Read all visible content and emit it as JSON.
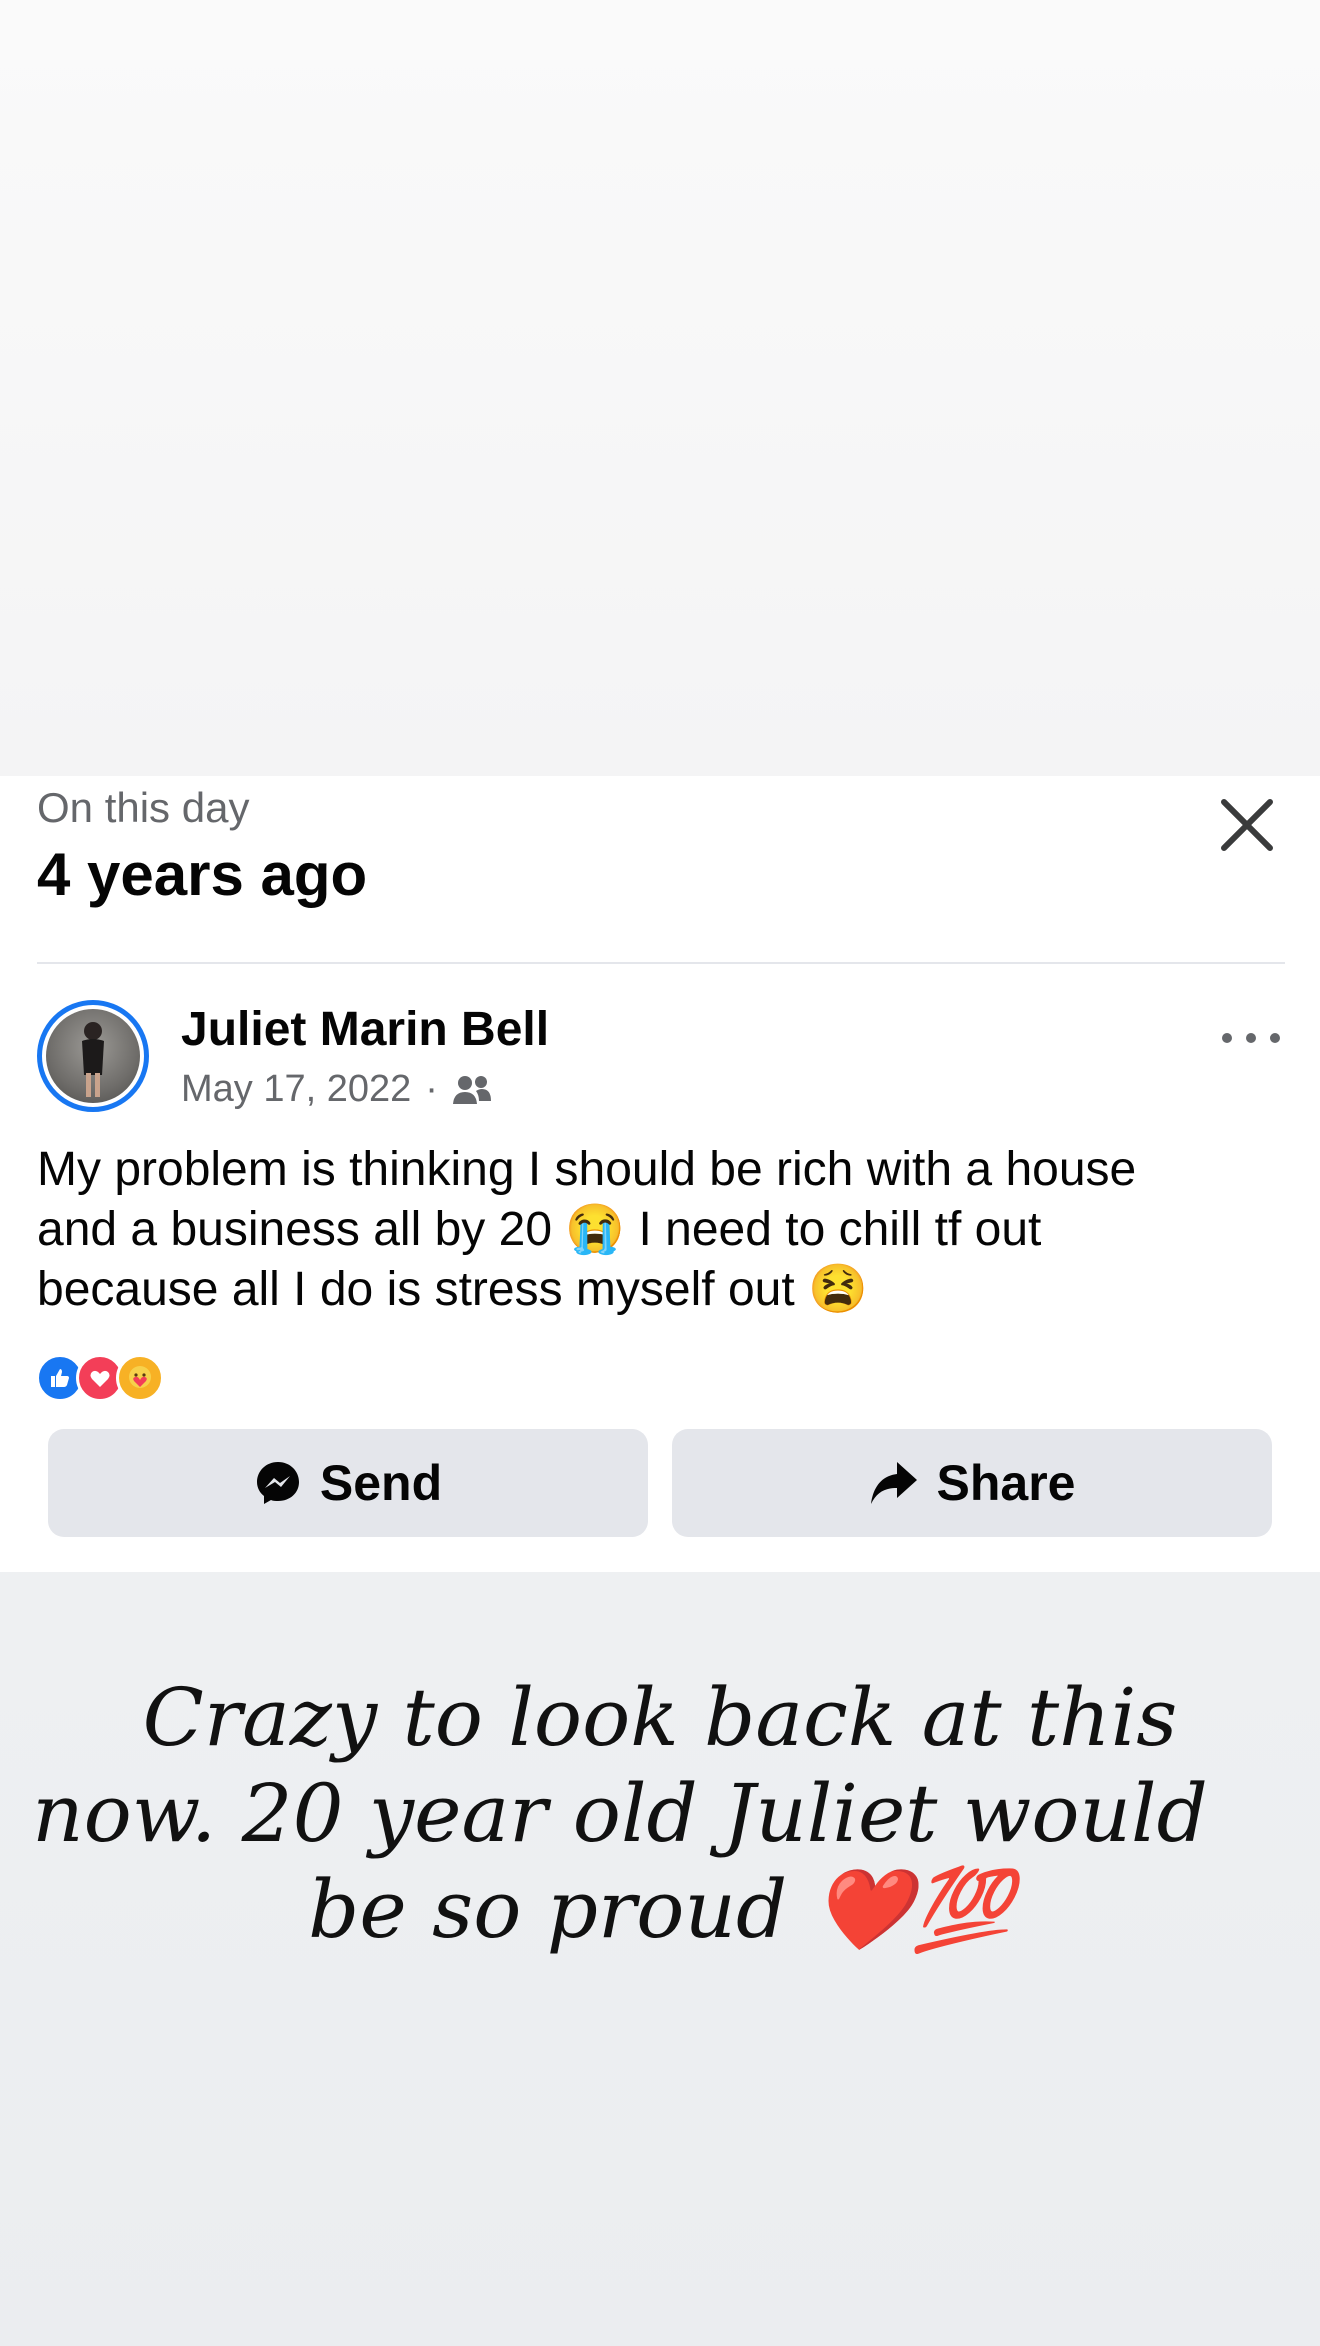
{
  "memory_card": {
    "kicker": "On this day",
    "headline": "4 years ago",
    "close_icon": "close-icon"
  },
  "post": {
    "author": "Juliet Marin Bell",
    "date": "May 17, 2022",
    "separator": "·",
    "audience_icon": "friends-icon",
    "more_icon": "more-options-icon",
    "text_lines": [
      "My problem is thinking I should be rich with a house",
      "and a business all by 20 😭 I need to chill tf out",
      "because all I do is stress myself out 😫"
    ],
    "reactions": [
      "like",
      "love",
      "care"
    ]
  },
  "actions": {
    "send_label": "Send",
    "share_label": "Share"
  },
  "caption": {
    "lines": [
      "Crazy to look back at this",
      "now. 20 year old Juliet would",
      "be so proud ❤️💯"
    ]
  },
  "colors": {
    "accent_blue": "#1877f2",
    "love_red": "#f33e58",
    "care_yellow": "#f7b125",
    "button_bg": "#e4e6eb",
    "secondary_text": "#65676b"
  }
}
